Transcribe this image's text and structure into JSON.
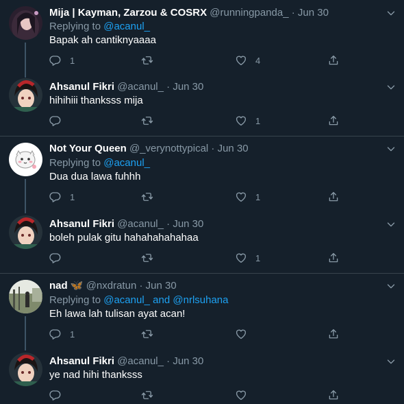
{
  "tweets": [
    {
      "name": "Mija | Kayman, Zarzou & COSRX",
      "handle": "@runningpanda_",
      "dot": "·",
      "date": "Jun 30",
      "replying_prefix": "Replying to",
      "mention1": "@acanul_",
      "text": "Bapak ah cantiknyaaaa",
      "reply_count": "1",
      "retweet_count": "",
      "like_count": "4"
    },
    {
      "name": "Ahsanul Fikri",
      "handle": "@acanul_",
      "dot": "·",
      "date": "Jun 30",
      "text": "hihihiii thanksss mija",
      "reply_count": "",
      "retweet_count": "",
      "like_count": "1"
    },
    {
      "name": "Not Your Queen",
      "handle": "@_verynottypical",
      "dot": "·",
      "date": "Jun 30",
      "replying_prefix": "Replying to",
      "mention1": "@acanul_",
      "text": "Dua dua lawa fuhhh",
      "reply_count": "1",
      "retweet_count": "",
      "like_count": "1"
    },
    {
      "name": "Ahsanul Fikri",
      "handle": "@acanul_",
      "dot": "·",
      "date": "Jun 30",
      "text": "boleh pulak gitu hahahahahahaa",
      "reply_count": "",
      "retweet_count": "",
      "like_count": "1"
    },
    {
      "name": "nad 🦋",
      "handle": "@nxdratun",
      "dot": "·",
      "date": "Jun 30",
      "replying_prefix": "Replying to",
      "mention1": "@acanul_",
      "and_word": "and",
      "mention2": "@nrlsuhana",
      "text": "Eh lawa lah tulisan ayat acan!",
      "reply_count": "1",
      "retweet_count": "",
      "like_count": ""
    },
    {
      "name": "Ahsanul Fikri",
      "handle": "@acanul_",
      "dot": "·",
      "date": "Jun 30",
      "text": "ye nad hihi thanksss",
      "reply_count": "",
      "retweet_count": "",
      "like_count": ""
    }
  ],
  "colors": {
    "background": "#15202b",
    "muted": "#8899a6",
    "accent": "#1da1f2",
    "divider": "#38444d"
  },
  "icons": [
    "reply-icon",
    "retweet-icon",
    "like-icon",
    "share-icon",
    "chevron-down-icon"
  ]
}
